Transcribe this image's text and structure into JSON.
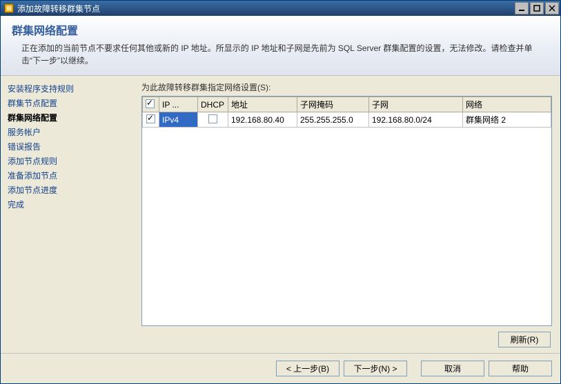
{
  "window": {
    "title": "添加故障转移群集节点"
  },
  "header": {
    "page_title": "群集网络配置",
    "description": "正在添加的当前节点不要求任何其他或新的 IP 地址。所显示的 IP 地址和子网是先前为 SQL Server 群集配置的设置，无法修改。请检查并单击“下一步”以继续。"
  },
  "sidebar": {
    "items": [
      "安装程序支持规则",
      "群集节点配置",
      "群集网络配置",
      "服务帐户",
      "错误报告",
      "添加节点规则",
      "准备添加节点",
      "添加节点进度",
      "完成"
    ],
    "active_index": 2
  },
  "main": {
    "instruction": "为此故障转移群集指定网络设置(S):",
    "columns": {
      "check": "",
      "ip": "IP ...",
      "dhcp": "DHCP",
      "addr": "地址",
      "mask": "子网掩码",
      "subnet": "子网",
      "network": "网络"
    },
    "rows": [
      {
        "checked": true,
        "ip": "IPv4",
        "dhcp_checked": false,
        "addr": "192.168.80.40",
        "mask": "255.255.255.0",
        "subnet": "192.168.80.0/24",
        "network": "群集网络 2"
      }
    ],
    "refresh_btn": "刷新(R)"
  },
  "footer": {
    "back": "< 上一步(B)",
    "next": "下一步(N) >",
    "cancel": "取消",
    "help": "帮助"
  }
}
